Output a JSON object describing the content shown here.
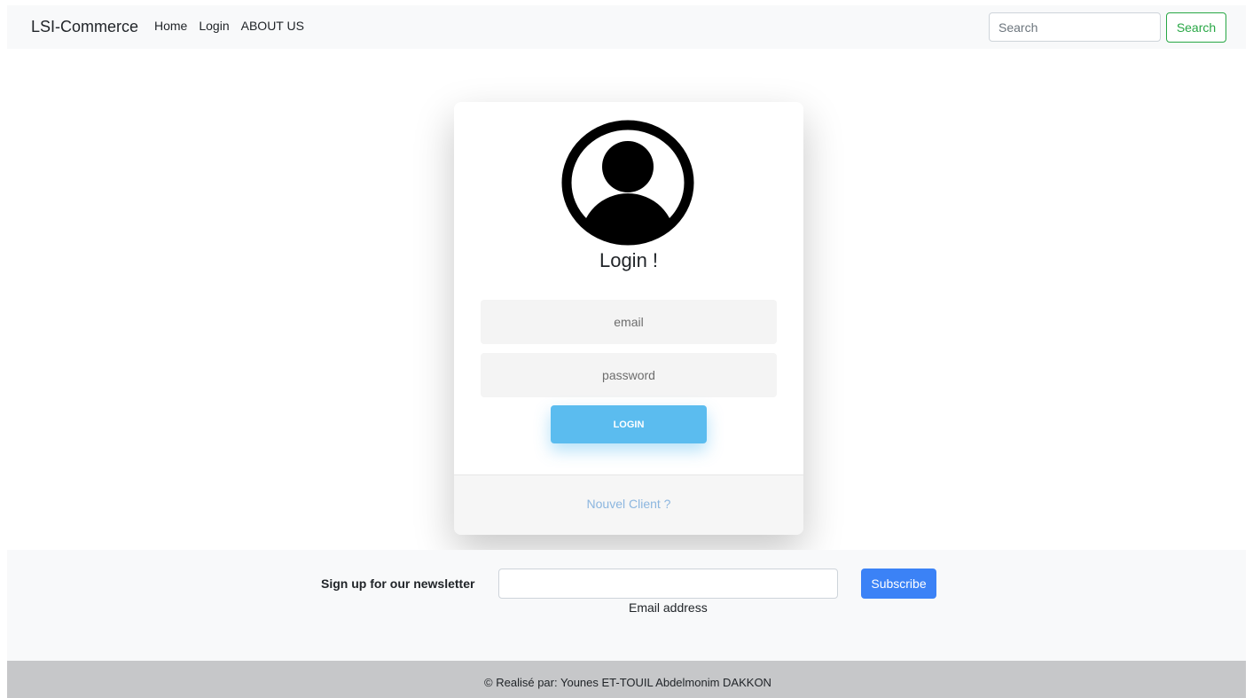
{
  "navbar": {
    "brand": "LSI-Commerce",
    "links": [
      "Home",
      "Login",
      "ABOUT US"
    ],
    "search_placeholder": "Search",
    "search_button": "Search"
  },
  "login_card": {
    "avatar_icon": "user-circle-icon",
    "title": "Login !",
    "email_placeholder": "email",
    "password_placeholder": "password",
    "login_button": "LOGIN",
    "new_client_link": "Nouvel Client ?"
  },
  "newsletter": {
    "label": "Sign up for our newsletter",
    "email_help": "Email address",
    "subscribe_button": "Subscribe"
  },
  "footer": {
    "copyright": "© Realisé par: Younes ET-TOUIL Abdelmonim DAKKON"
  },
  "colors": {
    "login_button": "#5bbcef",
    "subscribe_button": "#3b82f6",
    "search_button": "#28a745",
    "footer_bg": "#c6c7c9",
    "link": "#8cb6df"
  }
}
